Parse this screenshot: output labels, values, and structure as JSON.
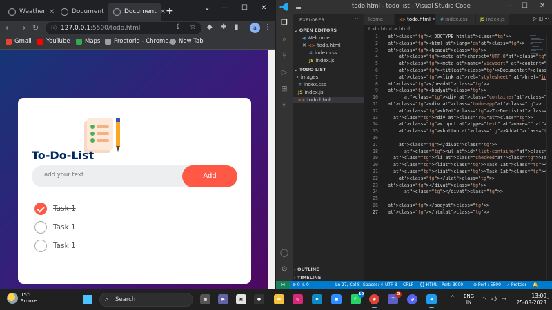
{
  "chrome": {
    "tabs": [
      {
        "label": "Weather",
        "active": false
      },
      {
        "label": "Document",
        "active": false
      },
      {
        "label": "Document",
        "active": true
      }
    ],
    "new_tab_symbol": "+",
    "window_controls": [
      "⌄",
      "—",
      "☐",
      "✕"
    ],
    "url_host": "127.0.0.1",
    "url_path": ":5500/todo.html",
    "profile_initial": "a",
    "bookmarks": [
      {
        "label": "Gmail",
        "icon": "gmail-icon",
        "color": "#ea4335"
      },
      {
        "label": "YouTube",
        "icon": "youtube-icon",
        "color": "#ff0000"
      },
      {
        "label": "Maps",
        "icon": "maps-icon",
        "color": "#34a853"
      },
      {
        "label": "Proctorio - Chrome...",
        "icon": "proctorio-icon",
        "color": "#9aa0a6"
      },
      {
        "label": "New Tab",
        "icon": "globe-icon",
        "color": "#9aa0a6"
      }
    ]
  },
  "app": {
    "title": "To-Do-List",
    "input_placeholder": "add your text",
    "add_label": "Add",
    "accent": "#ff5945",
    "title_color": "#002765",
    "tasks": [
      {
        "label": "Task 1",
        "checked": true
      },
      {
        "label": "Task 1",
        "checked": false
      },
      {
        "label": "Task 1",
        "checked": false
      }
    ]
  },
  "vscode": {
    "title": "todo.html - todo list - Visual Studio Code",
    "explorer_label": "EXPLORER",
    "open_editors_label": "OPEN EDITORS",
    "open_editors": [
      {
        "label": "Welcome",
        "icon": "vscode-icon"
      },
      {
        "label": "todo.html",
        "icon": "html-icon",
        "close": true
      },
      {
        "label": "index.css",
        "icon": "css-icon"
      },
      {
        "label": "index.js",
        "icon": "js-icon"
      }
    ],
    "folder_label": "TODO LIST",
    "files": [
      {
        "label": "images",
        "icon": "folder-icon"
      },
      {
        "label": "index.css",
        "icon": "css-icon"
      },
      {
        "label": "index.js",
        "icon": "js-icon"
      },
      {
        "label": "todo.html",
        "icon": "html-icon",
        "selected": true
      }
    ],
    "outline_label": "OUTLINE",
    "timeline_label": "TIMELINE",
    "tabs": [
      {
        "label": "lcome",
        "active": false
      },
      {
        "label": "todo.html",
        "active": true
      },
      {
        "label": "index.css",
        "active": false
      },
      {
        "label": "index.js",
        "active": false
      }
    ],
    "tab_icons": "▷ ◫ ···",
    "breadcrumb": "todo.html > html",
    "code_lines": [
      "<!DOCTYPE html>",
      "<html lang=\"en\">",
      "<head>",
      "    <meta charset=\"UTF-8\">",
      "    <meta name=\"viewport\" content=\"width=device-wid",
      "    <title>Document</title>",
      "    <link rel=\"stylesheet\" href=\"index.css\">",
      "</head>",
      "<body>",
      "      <div class=\"container\">",
      "<div class=\"todo-app\">",
      "    <h2>To-Do-List</h2><img src=\"images/icon.png\">",
      "  <div class=\"row\">",
      "    <input type=\"text\" name=\"\" id=\"input-box\" place",
      "    <button >Add</button>",
      "",
      "    </div>",
      "      <ul id=\"list-container\">",
      "  <li class=\"checked\">Task 1</li>",
      "  <li>Task 1</li>",
      "  <li>Task 1</li>",
      "    </ul>",
      "</div>",
      "      </div>",
      "",
      "</body>",
      "</html>"
    ],
    "current_line": 27,
    "status": {
      "errors": "⊗ 0 ⚠ 0",
      "position": "Ln 27, Col 8",
      "spaces": "Spaces: 4",
      "encoding": "UTF-8",
      "eol": "CRLF",
      "language": "{} HTML",
      "port": "Port: 3000",
      "port2": "⊘ Port : 5500",
      "prettier": "✓ Prettier"
    }
  },
  "taskbar": {
    "temp": "15°C",
    "weather": "Smoke",
    "search_label": "Search",
    "apps": [
      {
        "icon": "file-explorer-icon",
        "color": "#f3c33b",
        "label": ""
      },
      {
        "icon": "instagram-icon",
        "color": "#d62976",
        "label": ""
      },
      {
        "icon": "edge-icon",
        "color": "#0c8ac6",
        "label": ""
      },
      {
        "icon": "zoom-icon",
        "color": "#2d8cff",
        "label": ""
      },
      {
        "icon": "whatsapp-icon",
        "color": "#25d366",
        "label": "",
        "badge": "16"
      },
      {
        "icon": "chrome-icon",
        "color": "#db4437",
        "label": "",
        "active": true
      },
      {
        "icon": "teams-icon",
        "color": "#5b5fc7",
        "label": "",
        "badge": "5"
      },
      {
        "icon": "discord-icon",
        "color": "#5865f2",
        "label": ""
      },
      {
        "icon": "vscode-icon",
        "color": "#1f9cf0",
        "label": "",
        "active": true
      }
    ],
    "lang_top": "ENG",
    "lang_bottom": "IN",
    "time": "13:00",
    "date": "25-08-2023"
  }
}
